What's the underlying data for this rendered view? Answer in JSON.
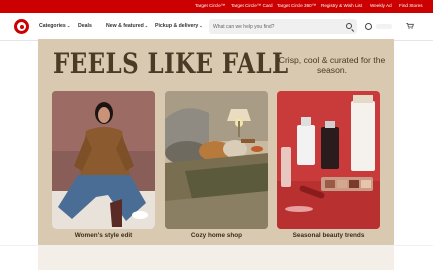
{
  "utility_links": [
    {
      "label": "Target Circle™"
    },
    {
      "label": "Target Circle™ Card"
    },
    {
      "label": "Target Circle 360™"
    },
    {
      "label": "Registry & Wish List"
    },
    {
      "label": "Weekly Ad"
    },
    {
      "label": "Find Stores"
    }
  ],
  "nav": {
    "items": [
      {
        "label": "Categories",
        "has_chevron": true
      },
      {
        "label": "Deals",
        "has_chevron": false
      },
      {
        "label": "New & featured",
        "has_chevron": true
      },
      {
        "label": "Pickup & delivery",
        "has_chevron": true
      }
    ],
    "chevron": "⌄"
  },
  "search": {
    "placeholder": "What can we help you find?",
    "value": ""
  },
  "icons": {
    "logo": "target-bullseye",
    "search": "magnifier",
    "account": "person",
    "cart": "shopping-cart"
  },
  "colors": {
    "brand_red": "#cc0000",
    "hero_bg": "#d9c9b0",
    "hero_text": "#4a3a26"
  },
  "hero": {
    "title": "FEELS LIKE FALL",
    "subtitle": "Crisp, cool & curated for the season.",
    "cards": [
      {
        "label": "Women's style edit",
        "image": "woman in brown sweater and jeans"
      },
      {
        "label": "Cozy home shop",
        "image": "bed with throw pillows and lamp"
      },
      {
        "label": "Seasonal beauty trends",
        "image": "beauty products on red background"
      }
    ]
  }
}
